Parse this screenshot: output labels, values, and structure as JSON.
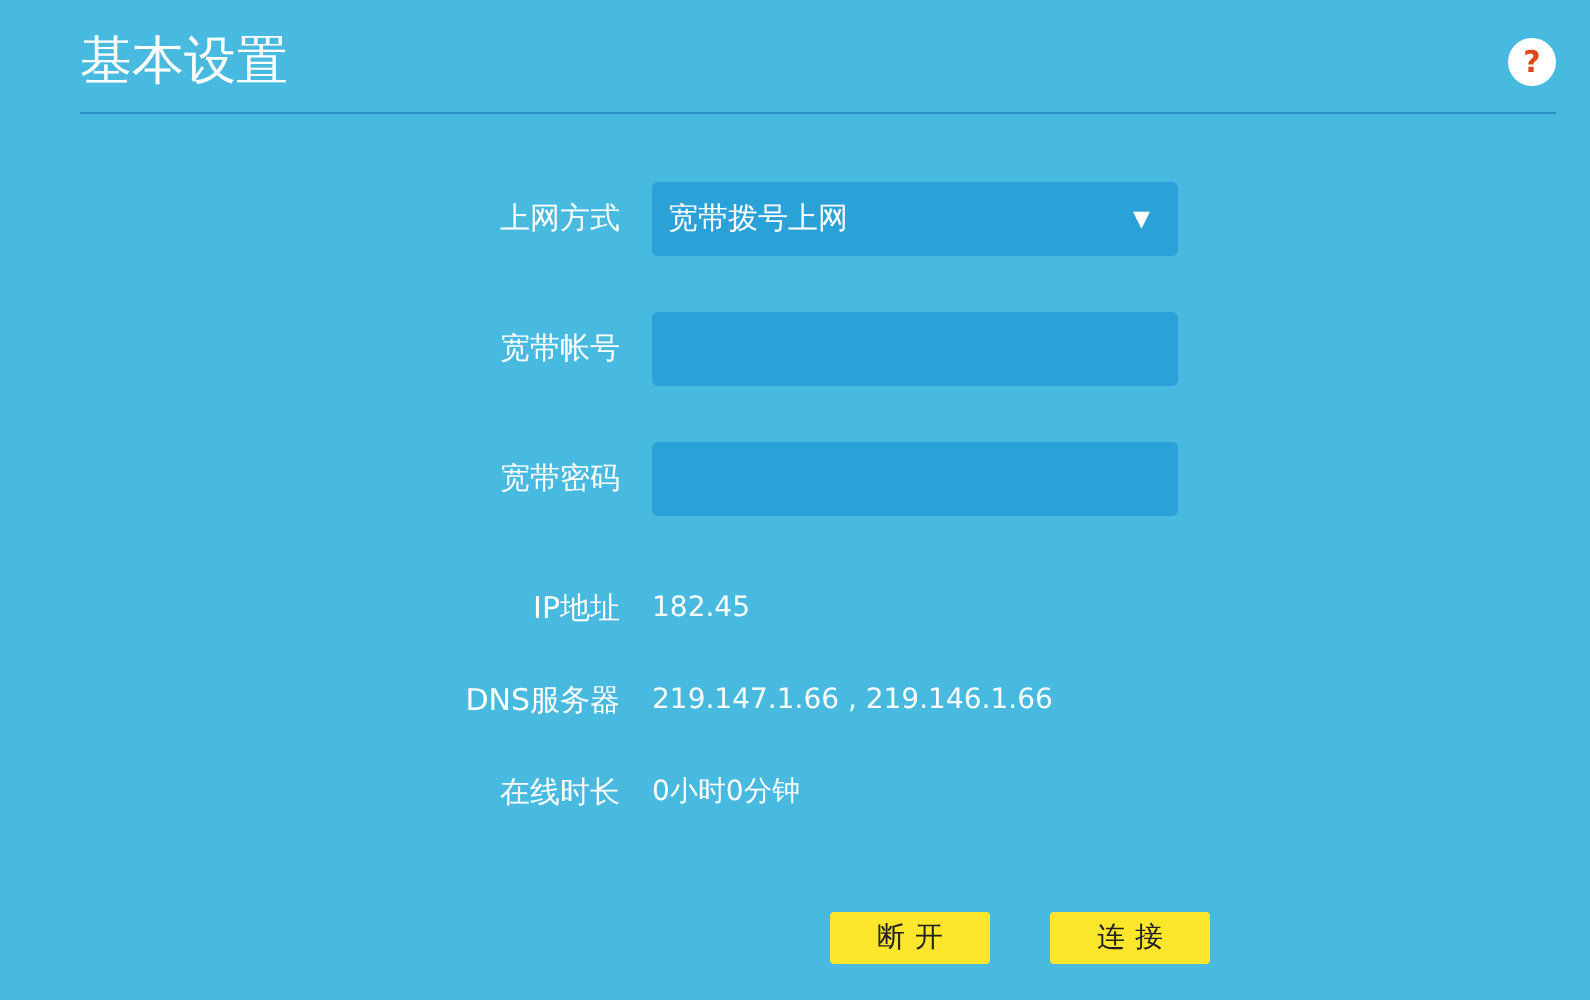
{
  "header": {
    "title": "基本设置",
    "help": "?"
  },
  "form": [
    {
      "kind": "select",
      "label": "上网方式",
      "value": "宽带拨号上网",
      "caret": "▼"
    },
    {
      "kind": "input",
      "label": "宽带帐号"
    },
    {
      "kind": "input",
      "label": "宽带密码"
    },
    {
      "kind": "text",
      "label": "IP地址",
      "value": "182.45"
    },
    {
      "kind": "text",
      "label": "DNS服务器",
      "value": "219.147.1.66 , 219.146.1.66"
    },
    {
      "kind": "text",
      "label": "在线时长",
      "value": "0小时0分钟"
    }
  ],
  "buttons": [
    "断开",
    "连接"
  ]
}
